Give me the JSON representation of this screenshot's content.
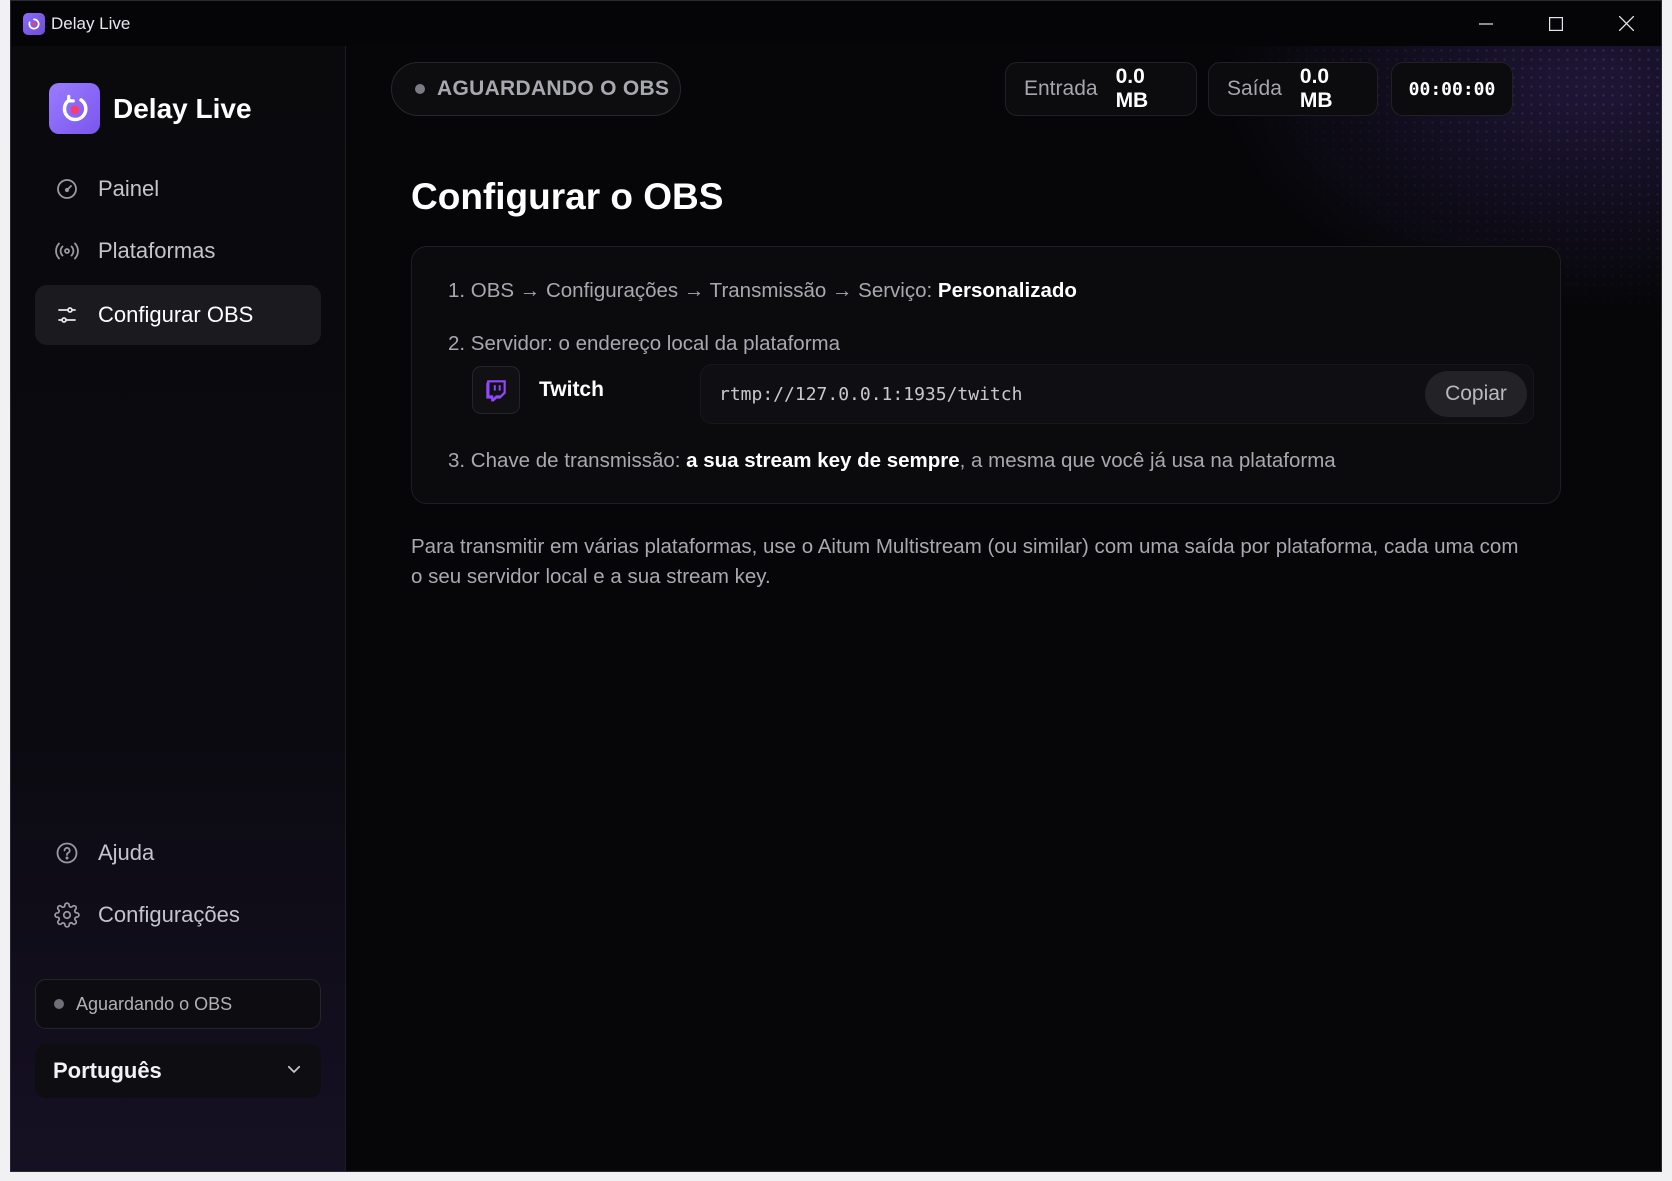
{
  "window": {
    "title": "Delay Live",
    "controls": {
      "minimize": "minimize-icon",
      "maximize": "maximize-icon",
      "close": "close-icon"
    }
  },
  "sidebar": {
    "brand": "Delay Live",
    "items": [
      {
        "label": "Painel",
        "icon": "gauge-icon"
      },
      {
        "label": "Plataformas",
        "icon": "broadcast-icon"
      },
      {
        "label": "Configurar OBS",
        "icon": "sliders-icon",
        "active": true
      }
    ],
    "bottom_items": [
      {
        "label": "Ajuda",
        "icon": "help-circle-icon"
      },
      {
        "label": "Configurações",
        "icon": "gear-icon"
      }
    ],
    "status": "Aguardando o OBS",
    "language": "Português"
  },
  "header": {
    "status": "AGUARDANDO O OBS",
    "input_label": "Entrada",
    "input_value": "0.0 MB",
    "output_label": "Saída",
    "output_value": "0.0 MB",
    "timer": "00:00:00"
  },
  "main": {
    "title": "Configurar o OBS",
    "step1_prefix": "1. OBS → Configurações → Transmissão → Serviço: ",
    "step1_bold": "Personalizado",
    "step2": "2. Servidor: o endereço local da plataforma",
    "platform_name": "Twitch",
    "server_url": "rtmp://127.0.0.1:1935/twitch",
    "copy_label": "Copiar",
    "step3_prefix": "3. Chave de transmissão: ",
    "step3_bold": "a sua stream key de sempre",
    "step3_suffix": ", a mesma que você já usa na plataforma",
    "note": "Para transmitir em várias plataformas, use o Aitum Multistream (ou similar) com uma saída por plataforma, cada uma com o seu servidor local e a sua stream key."
  },
  "colors": {
    "accent": "#8b6cf6",
    "twitch": "#9146ff",
    "background": "#060608"
  }
}
